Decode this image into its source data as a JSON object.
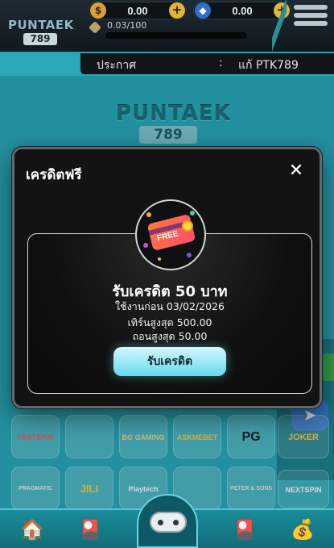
{
  "header": {
    "logo_word": "PUNTAEK",
    "logo_number": "789",
    "currency_1_value": "0.00",
    "currency_2_value": "0.00",
    "exp_text": "0.03/100",
    "colors": {
      "accent": "#1ea4b4",
      "plus": "#e2b43a"
    }
  },
  "announcement": {
    "label": "ประกาศ",
    "separator": ":",
    "text": "แก้ PTK789"
  },
  "background": {
    "logo_word": "PUNTAEK",
    "logo_number": "789",
    "providers": [
      "FASTSPIN",
      "",
      "BG GAMING",
      "ASKMEBET",
      "PG",
      "JOKER",
      "PRAGMATIC PLAY",
      "JILI",
      "Playtech",
      "",
      "PETER & SONS",
      "NEXTSPIN"
    ]
  },
  "modal": {
    "title": "เครดิตฟรี",
    "close_icon": "close-icon",
    "coupon_label": "FREE",
    "reward_title": "รับเครดิต 50 บาท",
    "use_before": "ใช้งานก่อน 03/02/2026",
    "max_turnover": "เทิร์นสูงสุด 500.00",
    "max_withdraw": "ถอนสูงสุด 50.00",
    "claim_button": "รับเครดิต",
    "colors": {
      "button": "#67d9ef",
      "card_border": "#d9d9d9"
    }
  },
  "bottom_nav": {
    "items": [
      "home-icon",
      "game-card-icon",
      "gamepad-icon",
      "game-card-icon",
      "money-bag-icon"
    ]
  }
}
